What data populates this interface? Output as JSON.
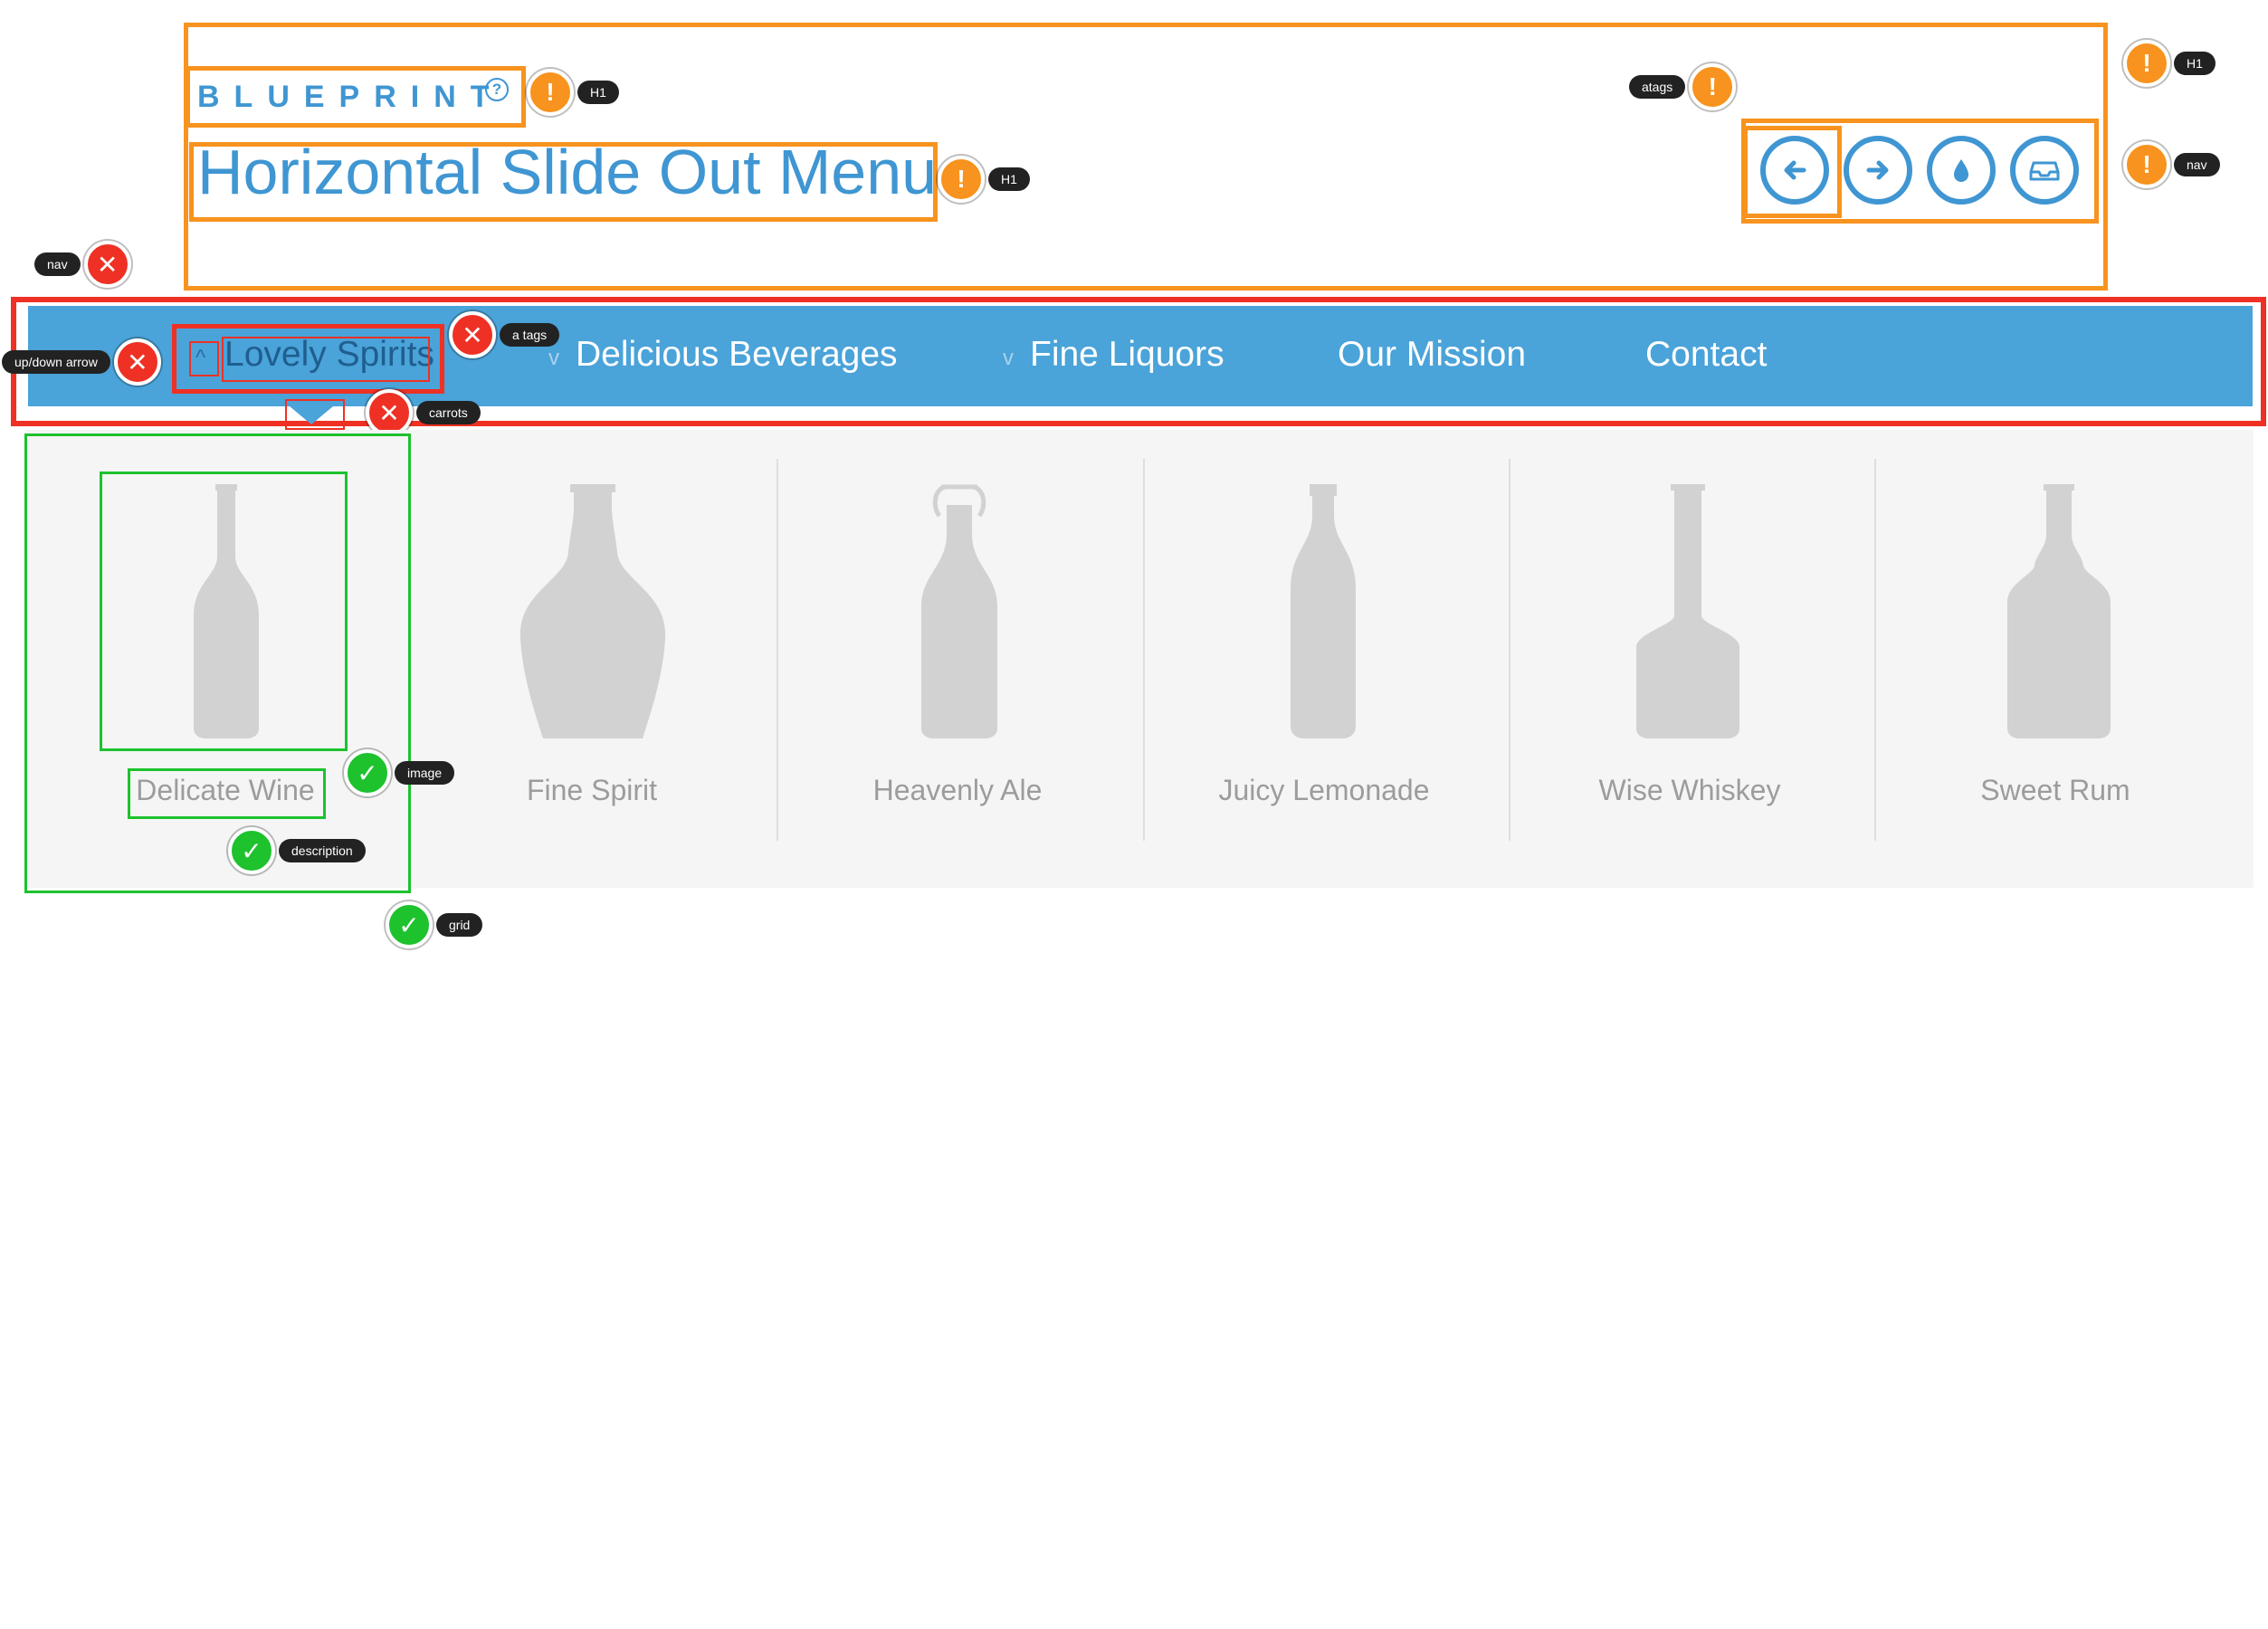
{
  "header": {
    "brand": "BLUEPRINT",
    "brand_help": "?",
    "title": "Horizontal Slide Out Menu",
    "icons": [
      "arrow-left-icon",
      "arrow-right-icon",
      "drop-icon",
      "inbox-icon"
    ]
  },
  "nav": {
    "items": [
      {
        "label": "Lovely Spirits",
        "has_chevron": true,
        "active": true
      },
      {
        "label": "Delicious Beverages",
        "has_chevron": true,
        "active": false
      },
      {
        "label": "Fine Liquors",
        "has_chevron": true,
        "active": false
      },
      {
        "label": "Our Mission",
        "has_chevron": false,
        "active": false
      },
      {
        "label": "Contact",
        "has_chevron": false,
        "active": false
      }
    ]
  },
  "products": [
    {
      "label": "Delicate Wine",
      "icon": "wine-bottle-icon"
    },
    {
      "label": "Fine Spirit",
      "icon": "spirit-bottle-icon"
    },
    {
      "label": "Heavenly Ale",
      "icon": "ale-bottle-icon"
    },
    {
      "label": "Juicy Lemonade",
      "icon": "lemonade-bottle-icon"
    },
    {
      "label": "Wise Whiskey",
      "icon": "whiskey-bottle-icon"
    },
    {
      "label": "Sweet Rum",
      "icon": "rum-bottle-icon"
    }
  ],
  "annotations": {
    "h1_brand": "H1",
    "h1_title": "H1",
    "h1_header": "H1",
    "atags": "atags",
    "nav_header": "nav",
    "nav_main": "nav",
    "a_tags": "a tags",
    "updown_arrow": "up/down arrow",
    "carrots": "carrots",
    "image": "image",
    "description": "description",
    "grid": "grid"
  },
  "colors": {
    "accent": "#3f96d2",
    "nav_bg": "#4aa3d9",
    "warning": "#f7931e",
    "error": "#ee3124",
    "pass": "#1dc22d"
  }
}
